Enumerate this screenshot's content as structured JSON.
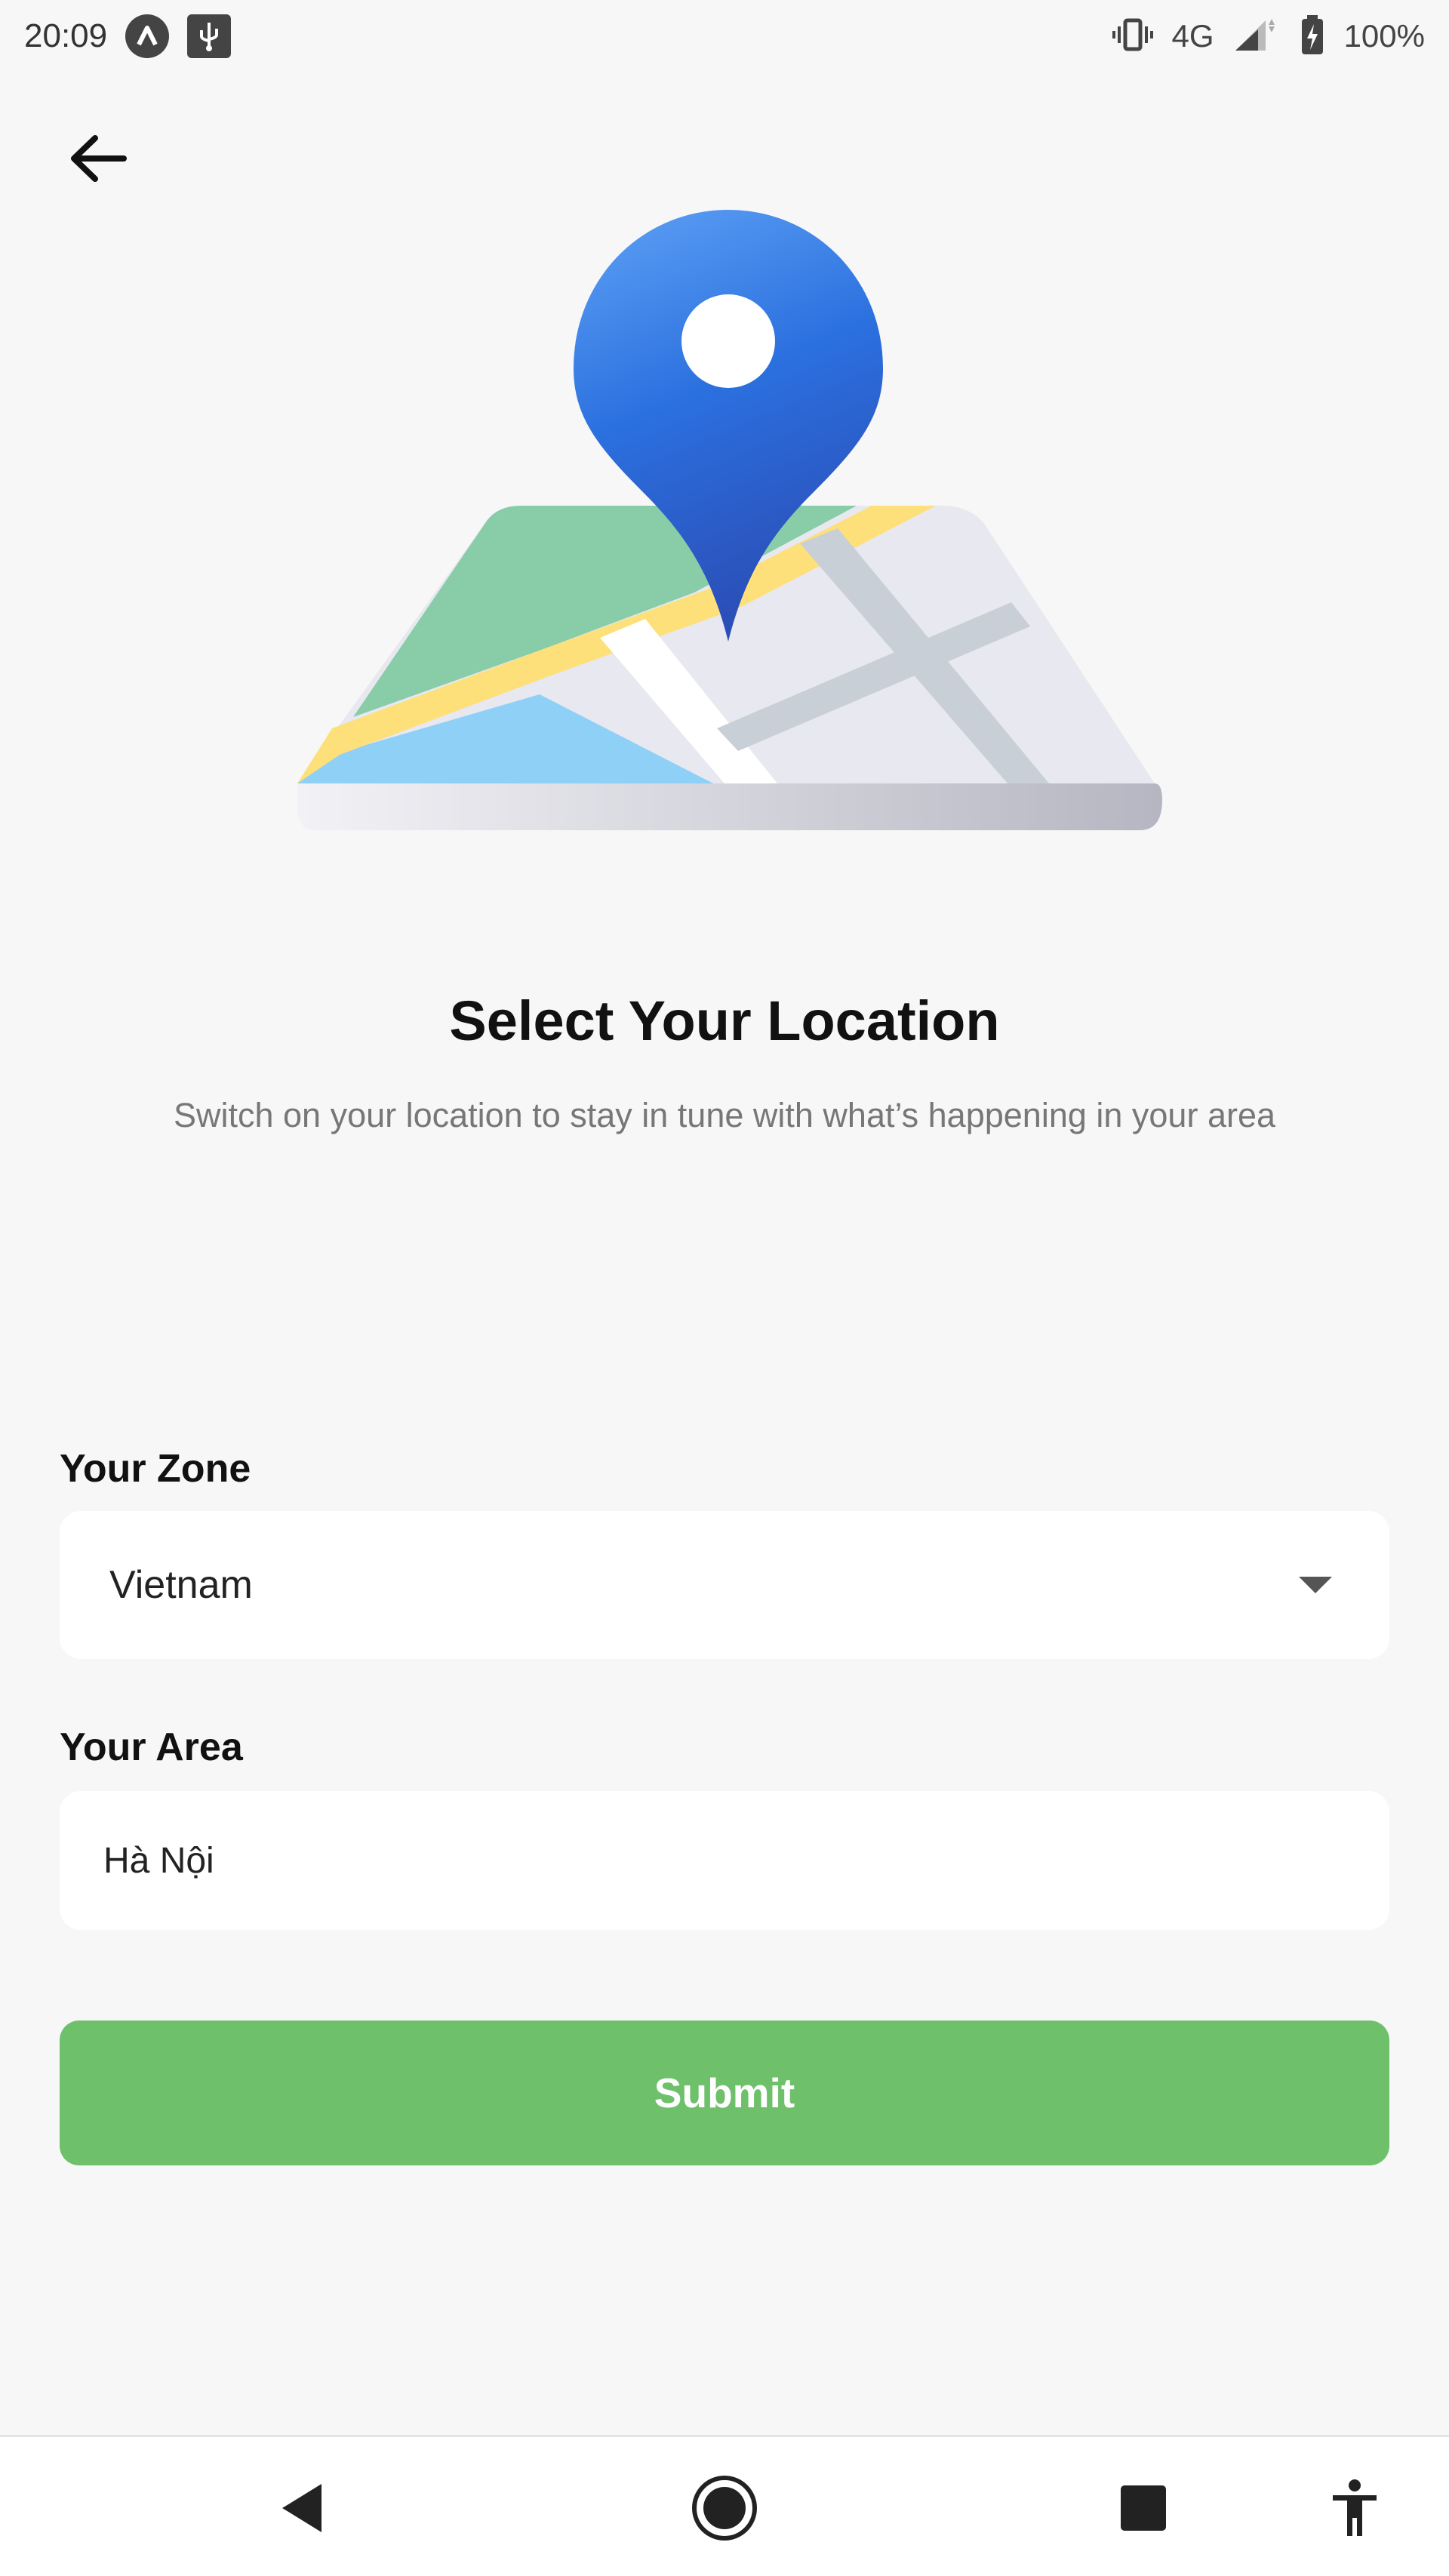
{
  "status_bar": {
    "time": "20:09",
    "network": "4G",
    "battery": "100%",
    "icons": [
      "notification-a-icon",
      "usb-icon",
      "vibrate-icon",
      "signal-icon",
      "battery-charging-icon"
    ]
  },
  "header": {
    "back_icon": "arrow-left-icon"
  },
  "illustration": {
    "name": "map-location-pin-illustration",
    "colors": {
      "pin": "#2f6fe0",
      "green": "#87cdaa",
      "yellow": "#fce17a",
      "blue": "#8ed0f8",
      "white_road": "#ffffff",
      "gray": "#e6e6ee"
    }
  },
  "content": {
    "title": "Select Your Location",
    "subtitle": "Switch on your location to stay in tune with what’s happening in your area"
  },
  "form": {
    "zone_label": "Your Zone",
    "zone_value": "Vietnam",
    "area_label": "Your Area",
    "area_value": "Hà Nội",
    "submit_label": "Submit"
  },
  "colors": {
    "background": "#f7f7f7",
    "submit": "#6ec06b",
    "field_background": "#ffffff"
  },
  "nav_bar": {
    "buttons": [
      "back-triangle-icon",
      "home-circle-icon",
      "recents-square-icon",
      "accessibility-icon"
    ]
  }
}
